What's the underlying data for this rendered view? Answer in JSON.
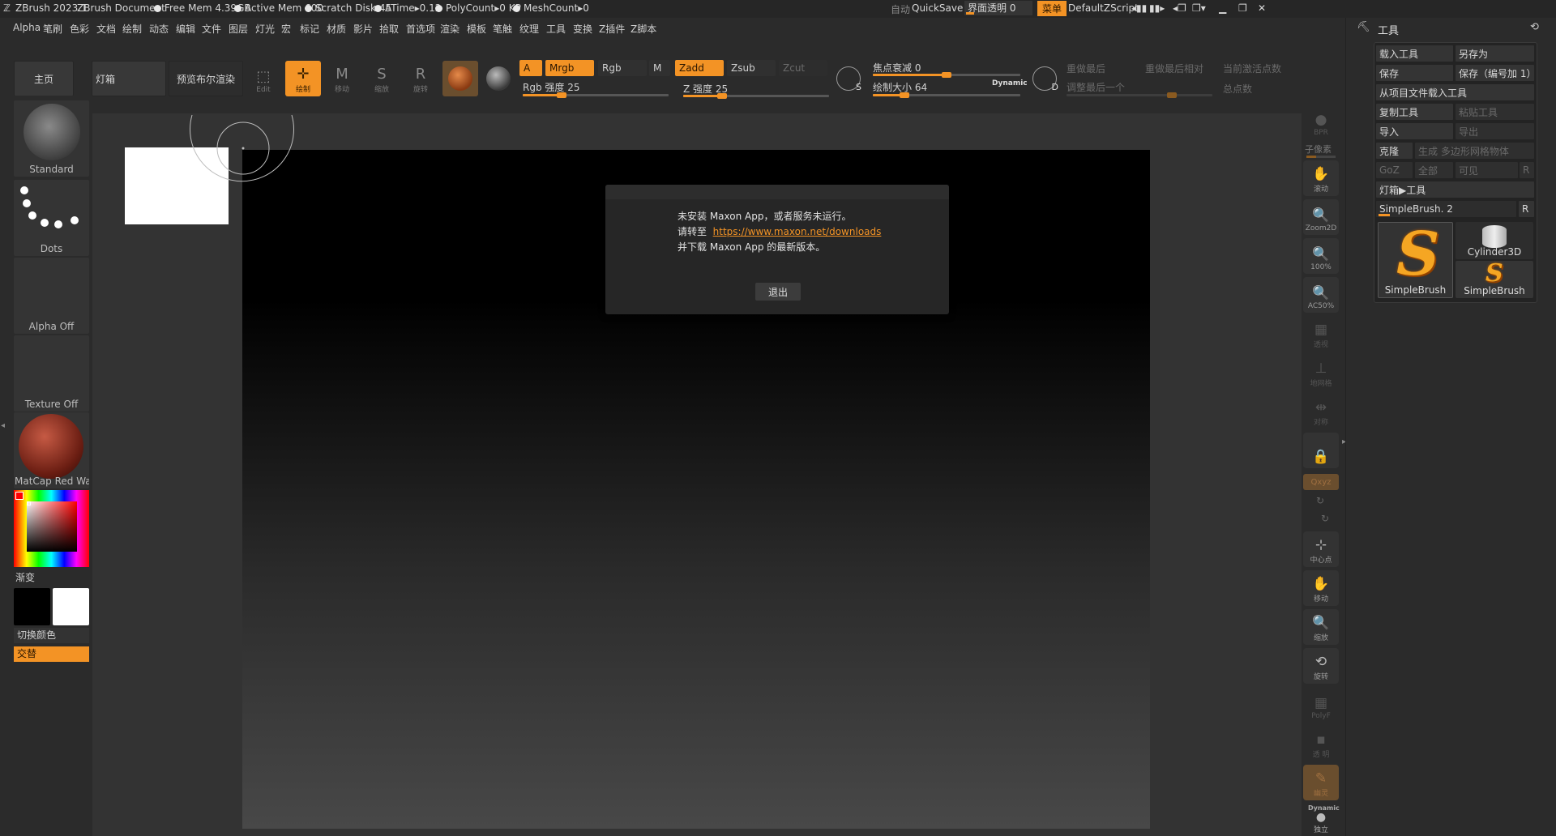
{
  "titlebar": {
    "app": "ZBrush 2023.1",
    "document": "ZBrush Document",
    "free_mem": "Free Mem 4.39GB",
    "active_mem": "Active Mem 600",
    "scratch_disk": "Scratch Disk 45",
    "atime": "ATime▸0.12",
    "polycount": "PolyCount▸0 KP",
    "meshcount": "MeshCount▸0",
    "auto": "自动",
    "quicksave": "QuickSave",
    "ui_opacity": "界面透明 0",
    "menu": "菜单",
    "script": "DefaultZScript"
  },
  "menubar": [
    "Alpha",
    "笔刷",
    "色彩",
    "文档",
    "绘制",
    "动态",
    "编辑",
    "文件",
    "图层",
    "灯光",
    "宏",
    "标记",
    "材质",
    "影片",
    "拾取",
    "首选项",
    "渲染",
    "模板",
    "笔触",
    "纹理",
    "工具",
    "变换",
    "Z插件",
    "Z脚本"
  ],
  "toolbar": {
    "home": "主页",
    "lightbox": "灯箱",
    "bpr_preview": "预览布尔渲染",
    "edit": "Edit",
    "draw": "绘制",
    "move": "移动",
    "scale": "缩放",
    "rotate": "旋转",
    "a": "A",
    "mrgb": "Mrgb",
    "rgb": "Rgb",
    "m": "M",
    "rgb_intensity": "Rgb 强度 25",
    "zadd": "Zadd",
    "zsub": "Zsub",
    "zcut": "Zcut",
    "z_intensity": "Z 强度 25",
    "s_letter": "S",
    "focal_shift": "焦点衰减 0",
    "draw_size": "绘制大小 64",
    "dynamic": "Dynamic",
    "d_letter": "D",
    "replay_last": "重做最后",
    "replay_last_rel": "重做最后相对",
    "adjust_last": "调整最后一个",
    "active_points": "当前激活点数",
    "total_points": "总点数"
  },
  "toolbar_values": {
    "rgb_intensity": 25,
    "z_intensity": 25,
    "focal_shift": 0,
    "draw_size": 64
  },
  "leftshelf": {
    "brush": "Standard",
    "stroke": "Dots",
    "alpha": "Alpha Off",
    "texture": "Texture Off",
    "material": "MatCap Red Wax",
    "gradient": "渐变",
    "switch_color": "切换颜色",
    "alternate": "交替"
  },
  "dialog": {
    "line1": "未安装 Maxon App，或者服务未运行。",
    "line2_prefix": "请转至",
    "link": "https://www.maxon.net/downloads",
    "line3": "并下载 Maxon App 的最新版本。",
    "exit": "退出"
  },
  "rightshelf": {
    "bpr": "BPR",
    "subpixel": "子像素",
    "scroll": "滚动",
    "zoom2d": "Zoom2D",
    "actual": "100%",
    "half": "AC50%",
    "persp": "透视",
    "floor": "地网格",
    "sym": "对称",
    "lock": "",
    "xyz": "Qxyz",
    "center": "中心点",
    "move": "移动",
    "scale": "缩放",
    "rotate": "旋转",
    "polyf": "PolyF",
    "transp": "透 明",
    "ghost": "幽灵",
    "dynamic": "Dynamic",
    "solo": "独立"
  },
  "toolpanel": {
    "title": "工具",
    "load_tool": "载入工具",
    "save_as": "另存为",
    "save": "保存",
    "save_inc": "保存（编号加 1）",
    "load_from_project": "从项目文件载入工具",
    "copy_tool": "复制工具",
    "paste_tool": "粘贴工具",
    "import": "导入",
    "export": "导出",
    "clone": "克隆",
    "make_polymesh": "生成 多边形网格物体",
    "goz": "GoZ",
    "all": "全部",
    "visible": "可见",
    "r": "R",
    "lightbox_tools": "灯箱▶工具",
    "current_tool": "SimpleBrush. 2",
    "tile1": "SimpleBrush",
    "tile2": "Cylinder3D",
    "tile3": "SimpleBrush"
  }
}
